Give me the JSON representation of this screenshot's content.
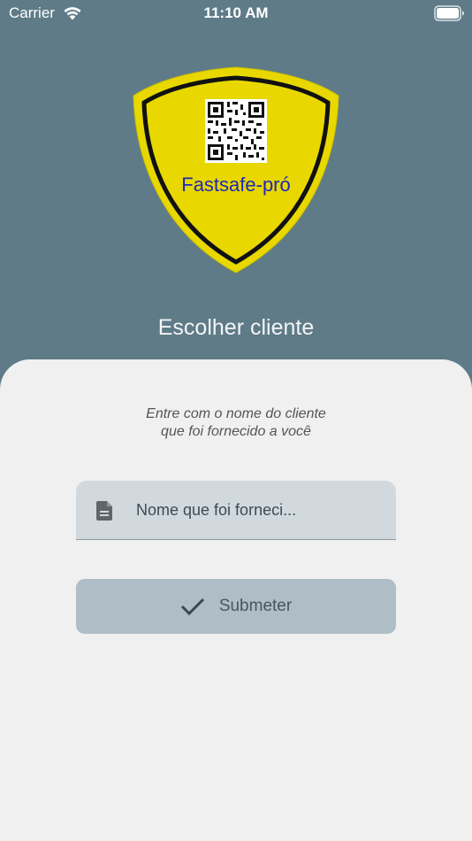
{
  "status_bar": {
    "carrier": "Carrier",
    "time": "11:10 AM"
  },
  "logo": {
    "text": "Fastsafe-pró",
    "shield_color": "#e8d800",
    "text_color": "#1e27b8"
  },
  "screen": {
    "title": "Escolher cliente"
  },
  "form": {
    "instructions_line1": "Entre com o nome do cliente",
    "instructions_line2": "que foi fornecido a você",
    "client_name_placeholder": "Nome que foi forneci...",
    "client_name_value": "",
    "submit_label": "Submeter"
  },
  "icons": {
    "field_icon": "document-icon",
    "submit_icon": "check-icon"
  },
  "colors": {
    "background": "#5f7b88",
    "panel": "#f0f0f0",
    "field": "#d1d9de",
    "button": "#afbec6"
  }
}
